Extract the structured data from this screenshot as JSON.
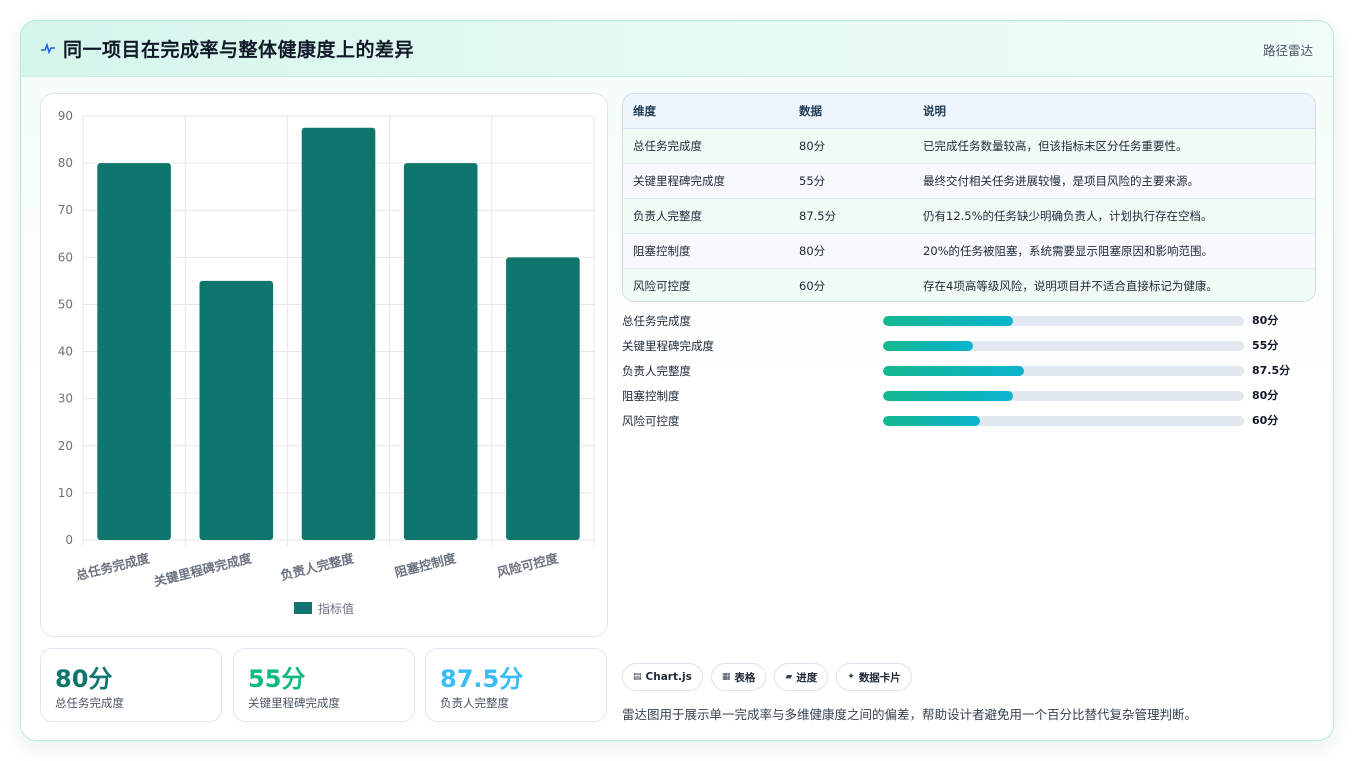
{
  "header": {
    "icon": "pulse-icon",
    "title": "同一项目在完成率与整体健康度上的差异",
    "tag": "路径雷达"
  },
  "colors": {
    "bar": "#0f766e",
    "kpi_1": "#0f766e",
    "kpi_2": "#10b981",
    "kpi_3": "#38bdf8",
    "accent_start": "#14b88f",
    "accent_end": "#0bb3cf"
  },
  "chart_data": {
    "type": "bar",
    "categories": [
      "总任务完成度",
      "关键里程碑完成度",
      "负责人完整度",
      "阻塞控制度",
      "风险可控度"
    ],
    "series": [
      {
        "name": "指标值",
        "values": [
          80,
          55,
          87.5,
          80,
          60
        ]
      }
    ],
    "ylim": [
      0,
      90
    ],
    "yticks": [
      0,
      10,
      20,
      30,
      40,
      50,
      60,
      70,
      80,
      90
    ],
    "grid": true,
    "legend": "bottom"
  },
  "kpis": [
    {
      "value": "80分",
      "label": "总任务完成度"
    },
    {
      "value": "55分",
      "label": "关键里程碑完成度"
    },
    {
      "value": "87.5分",
      "label": "负责人完整度"
    }
  ],
  "table": {
    "headers": [
      "维度",
      "数据",
      "说明"
    ],
    "rows": [
      [
        "总任务完成度",
        "80分",
        "已完成任务数量较高，但该指标未区分任务重要性。"
      ],
      [
        "关键里程碑完成度",
        "55分",
        "最终交付相关任务进展较慢，是项目风险的主要来源。"
      ],
      [
        "负责人完整度",
        "87.5分",
        "仍有12.5%的任务缺少明确负责人，计划执行存在空档。"
      ],
      [
        "阻塞控制度",
        "80分",
        "20%的任务被阻塞，系统需要显示阻塞原因和影响范围。"
      ],
      [
        "风险可控度",
        "60分",
        "存在4项高等级风险，说明项目并不适合直接标记为健康。"
      ]
    ]
  },
  "progress": [
    {
      "label": "总任务完成度",
      "value_text": "80分",
      "fraction": 0.36
    },
    {
      "label": "关键里程碑完成度",
      "value_text": "55分",
      "fraction": 0.25
    },
    {
      "label": "负责人完整度",
      "value_text": "87.5分",
      "fraction": 0.39
    },
    {
      "label": "阻塞控制度",
      "value_text": "80分",
      "fraction": 0.36
    },
    {
      "label": "风险可控度",
      "value_text": "60分",
      "fraction": 0.27
    }
  ],
  "chips": [
    {
      "icon": "chart-icon",
      "glyph": "▤",
      "label": "Chart.js"
    },
    {
      "icon": "table-icon",
      "glyph": "▦",
      "label": "表格"
    },
    {
      "icon": "progress-icon",
      "glyph": "▰",
      "label": "进度"
    },
    {
      "icon": "sparkle-icon",
      "glyph": "✦",
      "label": "数据卡片"
    }
  ],
  "footnote": "雷达图用于展示单一完成率与多维健康度之间的偏差，帮助设计者避免用一个百分比替代复杂管理判断。"
}
